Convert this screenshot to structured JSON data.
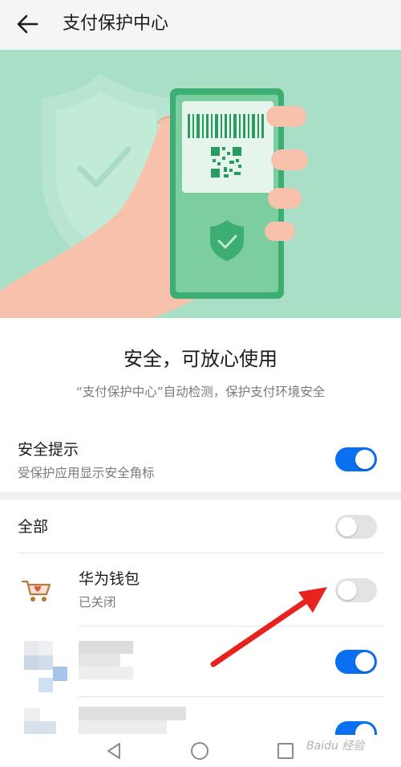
{
  "header": {
    "title": "支付保护中心",
    "back_icon": "arrow-left-icon"
  },
  "banner": {
    "background": "#a9dfc7",
    "illustration": "hand-holding-phone-with-qr-code-and-shield"
  },
  "intro": {
    "headline": "安全，可放心使用",
    "description": "“支付保护中心”自动检测，保护支付环境安全"
  },
  "security_tip": {
    "title": "安全提示",
    "subtitle": "受保护应用显示安全角标",
    "enabled": true
  },
  "all_apps": {
    "label": "全部",
    "enabled": false
  },
  "apps": [
    {
      "name": "华为钱包",
      "status": "已关闭",
      "enabled": false,
      "icon": "shopping-cart-heart-icon"
    },
    {
      "name": "",
      "status": "",
      "enabled": true,
      "icon": "blurred-app-icon"
    },
    {
      "name": "",
      "status": "",
      "enabled": true,
      "icon": "blurred-app-icon"
    }
  ],
  "annotation": {
    "color": "#e8231f",
    "points_to": "华为钱包 toggle"
  },
  "navbar": {
    "back": "triangle-back-icon",
    "home": "circle-home-icon",
    "recents": "square-recents-icon"
  },
  "watermark": "Baidu 经验",
  "colors": {
    "accent": "#0a6ff0",
    "toggle_off": "#e3e3e3",
    "secondary_text": "#7a7a7a"
  }
}
